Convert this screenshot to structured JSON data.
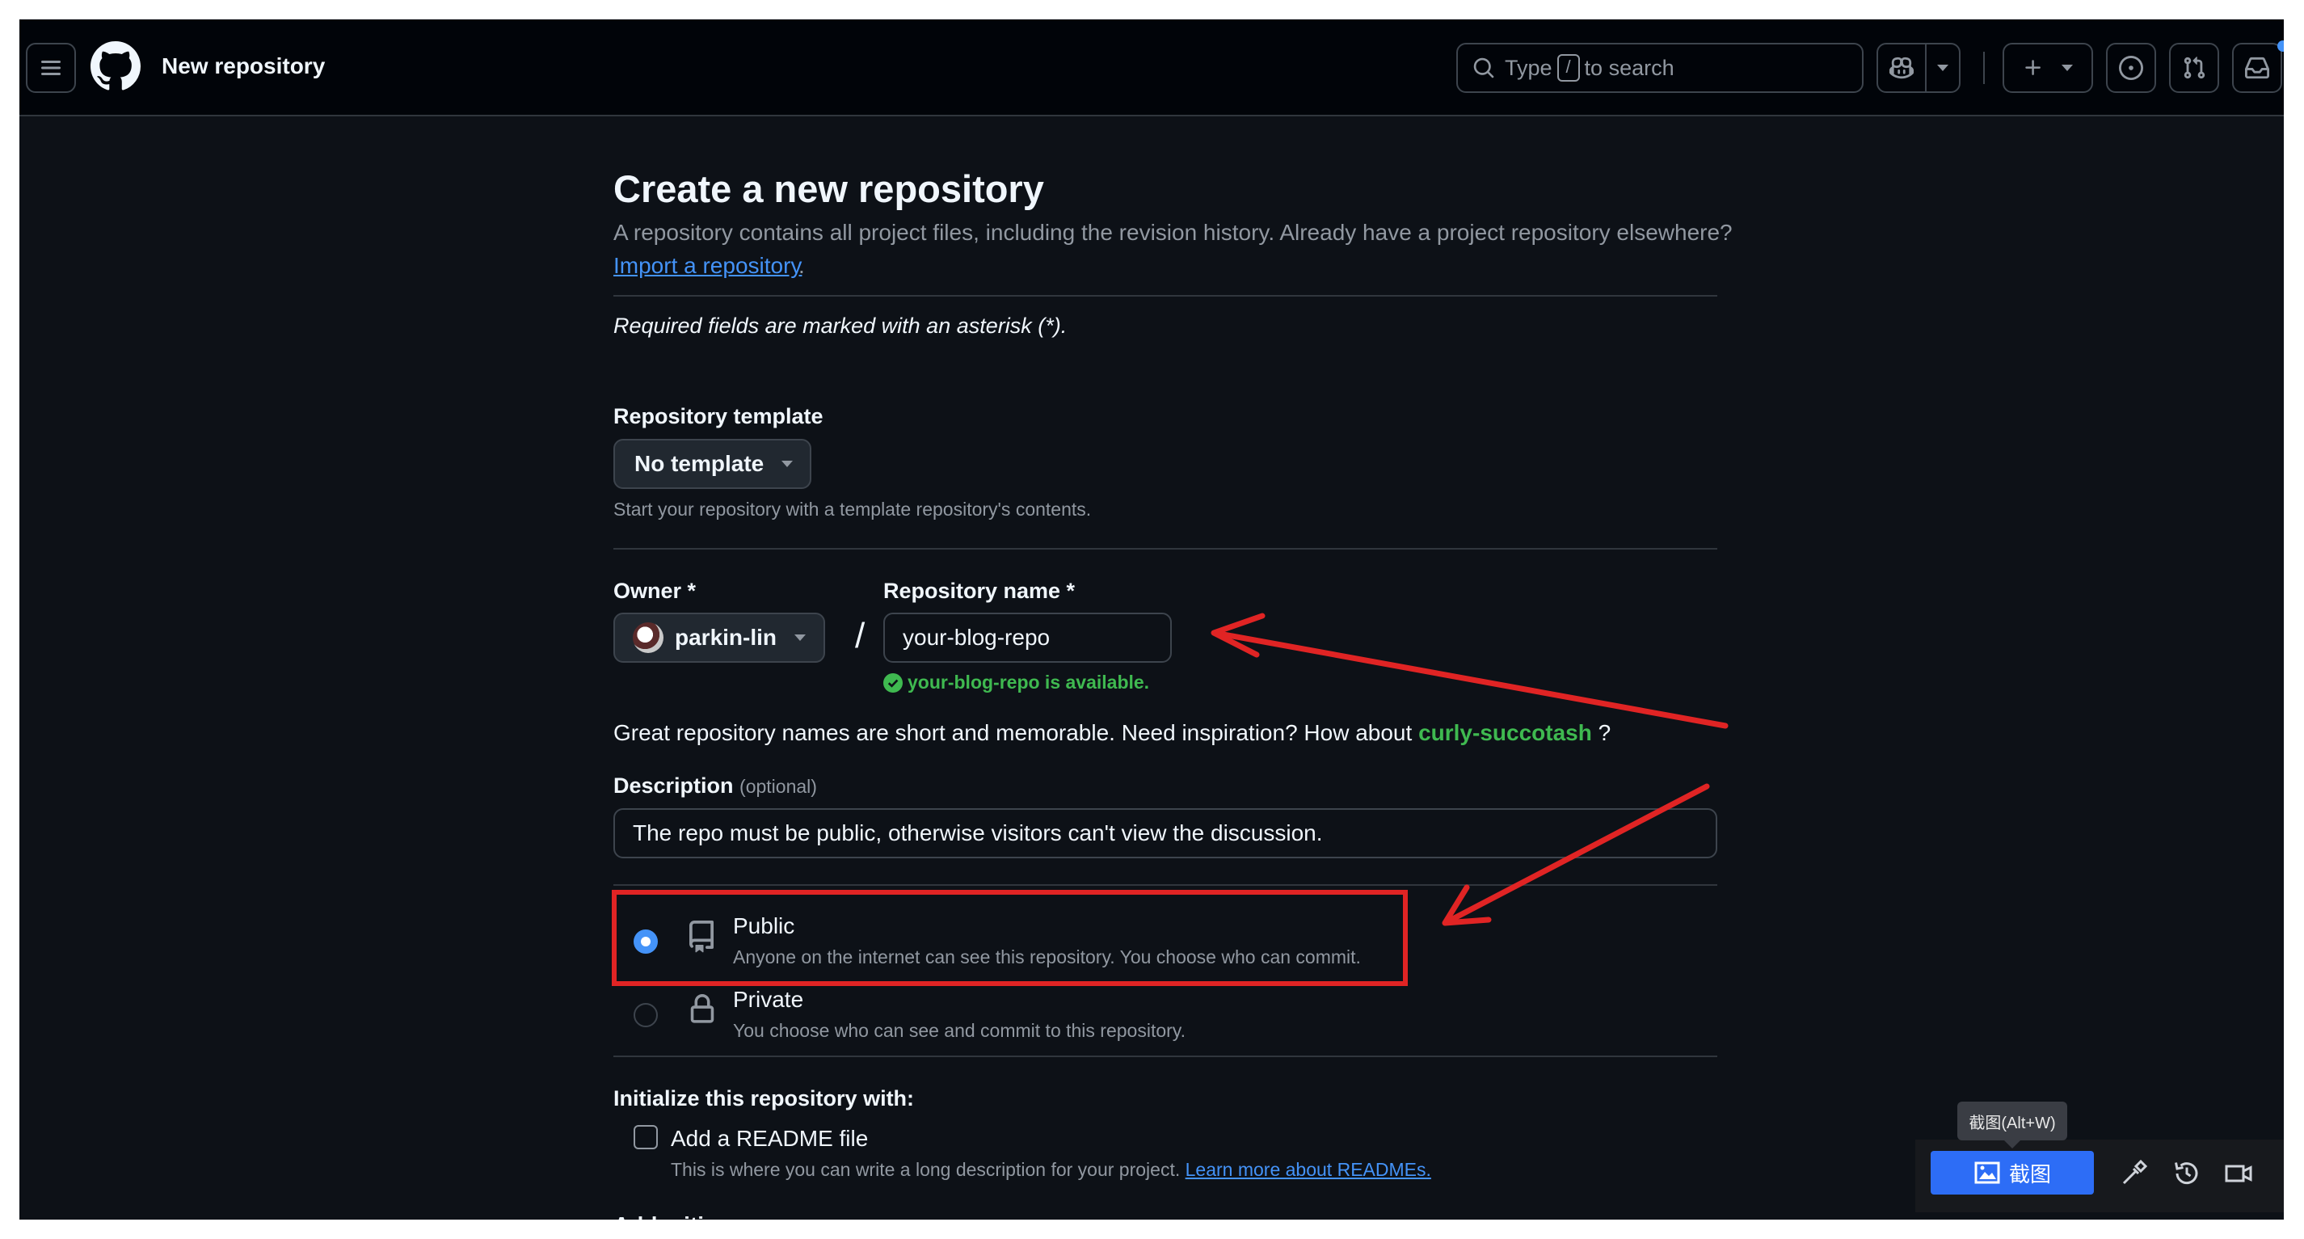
{
  "header": {
    "context_title": "New repository",
    "search": {
      "prefix": "Type",
      "key": "/",
      "suffix": "to search"
    }
  },
  "page": {
    "title": "Create a new repository",
    "lead": "A repository contains all project files, including the revision history. Already have a project repository elsewhere?",
    "import_link": "Import a repository",
    "import_suffix": ".",
    "required_note": "Required fields are marked with an asterisk (*)."
  },
  "template": {
    "label": "Repository template",
    "selected": "No template",
    "hint": "Start your repository with a template repository's contents."
  },
  "owner": {
    "label": "Owner *",
    "value": "parkin-lin"
  },
  "separator": "/",
  "repo_name": {
    "label": "Repository name *",
    "value": "your-blog-repo",
    "availability": "your-blog-repo is available."
  },
  "inspiration": {
    "text": "Great repository names are short and memorable. Need inspiration? How about",
    "suggestion": "curly-succotash",
    "suffix": "?"
  },
  "description": {
    "label": "Description",
    "optional": "(optional)",
    "value": "The repo must be public, otherwise visitors can't view the discussion."
  },
  "visibility": [
    {
      "title": "Public",
      "desc": "Anyone on the internet can see this repository. You choose who can commit.",
      "selected": true,
      "icon": "repo-icon"
    },
    {
      "title": "Private",
      "desc": "You choose who can see and commit to this repository.",
      "selected": false,
      "icon": "lock-icon"
    }
  ],
  "initialize": {
    "heading": "Initialize this repository with:",
    "readme_label": "Add a README file",
    "readme_hint": "This is where you can write a long description for your project.",
    "readme_link": "Learn more about READMEs.",
    "readme_checked": false,
    "next_heading_partial": "Add .gitignore"
  },
  "screenshot_tool": {
    "tooltip": "截图(Alt+W)",
    "button": "截图"
  },
  "colors": {
    "bg": "#0d1117",
    "header_bg": "#010409",
    "accent_blue": "#4493f8",
    "success_green": "#3fb950",
    "annotation_red": "#e02424"
  }
}
